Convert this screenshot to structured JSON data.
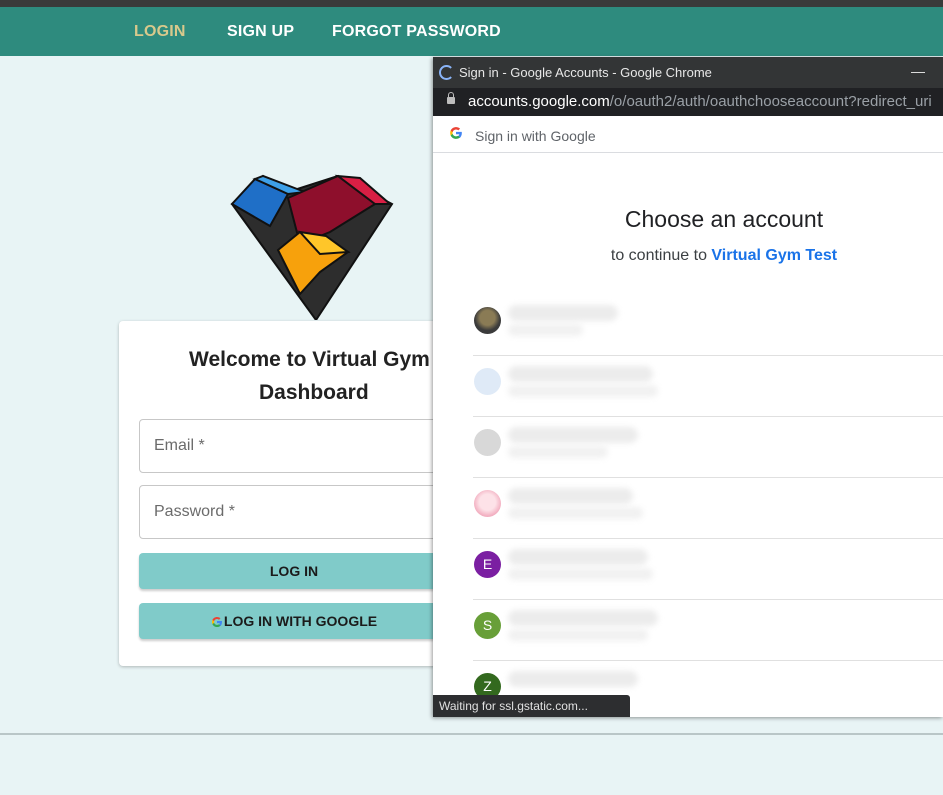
{
  "nav": {
    "items": [
      {
        "label": "LOGIN",
        "active": true
      },
      {
        "label": "SIGN UP",
        "active": false
      },
      {
        "label": "FORGOT PASSWORD",
        "active": false
      }
    ]
  },
  "login_card": {
    "title_line1": "Welcome to Virtual Gym",
    "title_line2": "Dashboard",
    "email_label": "Email *",
    "password_label": "Password *",
    "login_button": "LOG IN",
    "google_button": "LOG IN WITH GOOGLE"
  },
  "popup": {
    "window_title": "Sign in - Google Accounts - Google Chrome",
    "url_host": "accounts.google.com",
    "url_path": "/o/oauth2/auth/oauthchooseaccount?redirect_uri",
    "header_label": "Sign in with Google",
    "heading": "Choose an account",
    "continue_prefix": "to continue to",
    "app_name": "Virtual Gym Test",
    "accounts": [
      {
        "initial": "",
        "avatar_color": "#3b3b3b"
      },
      {
        "initial": "",
        "avatar_color": "#d6e6f7"
      },
      {
        "initial": "",
        "avatar_color": "#d8d8d8"
      },
      {
        "initial": "",
        "avatar_color": "#f6c9d2"
      },
      {
        "initial": "E",
        "avatar_color": "#7b1fa2"
      },
      {
        "initial": "S",
        "avatar_color": "#689f38"
      },
      {
        "initial": "Z",
        "avatar_color": "#33691e"
      }
    ],
    "status_text": "Waiting for ssl.gstatic.com..."
  },
  "colors": {
    "navbar": "#2e8b7e",
    "nav_active": "#d8c98c",
    "button": "#80cbc9",
    "link": "#1a73e8"
  }
}
